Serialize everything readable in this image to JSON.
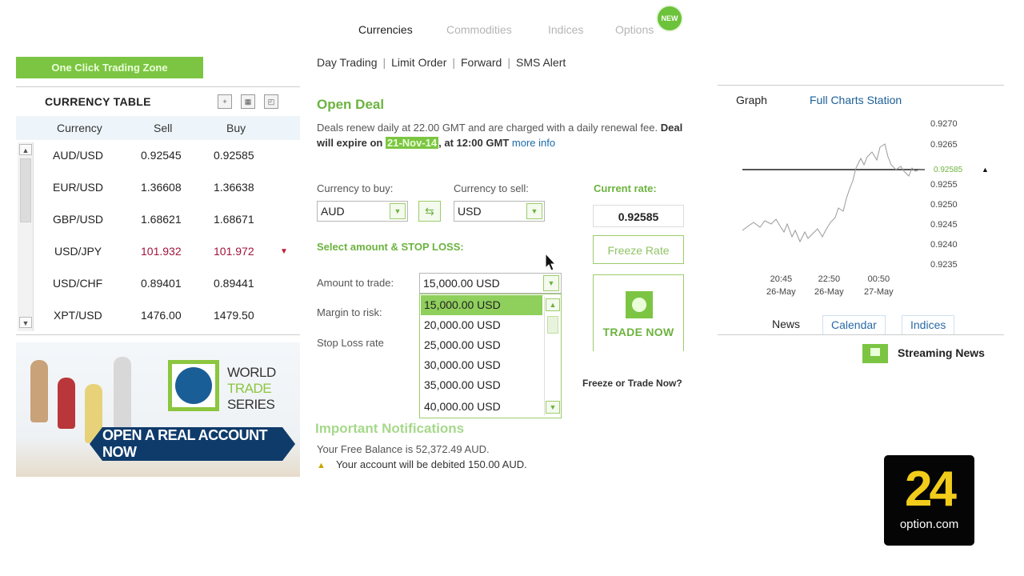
{
  "top_tabs": [
    "Currencies",
    "Commodities",
    "Indices",
    "Options"
  ],
  "new_badge": "NEW",
  "sub_nav": [
    "Day Trading",
    "Limit Order",
    "Forward",
    "SMS Alert"
  ],
  "one_click_label": "One Click Trading Zone",
  "currency_table": {
    "title": "CURRENCY TABLE",
    "columns": [
      "Currency",
      "Sell",
      "Buy"
    ],
    "rows": [
      {
        "pair": "AUD/USD",
        "sell": "0.92545",
        "buy": "0.92585"
      },
      {
        "pair": "EUR/USD",
        "sell": "1.36608",
        "buy": "1.36638"
      },
      {
        "pair": "GBP/USD",
        "sell": "1.68621",
        "buy": "1.68671"
      },
      {
        "pair": "USD/JPY",
        "sell": "101.932",
        "buy": "101.972"
      },
      {
        "pair": "USD/CHF",
        "sell": "0.89401",
        "buy": "0.89441"
      },
      {
        "pair": "XPT/USD",
        "sell": "1476.00",
        "buy": "1479.50"
      }
    ]
  },
  "banner": {
    "line1": "WORLD",
    "line2": "TRADE",
    "line3": "SERIES",
    "cta": "OPEN A REAL ACCOUNT NOW"
  },
  "deal": {
    "title": "Open Deal",
    "note_a": "Deals renew daily at 22.00 GMT and are charged with a daily renewal fee.",
    "note_b": "Deal will expire on",
    "date": "21-Nov-14",
    "note_c": ", at 12:00 GMT",
    "more_info": "more info",
    "buy_label": "Currency to buy:",
    "buy_value": "AUD",
    "sell_label": "Currency to sell:",
    "sell_value": "USD",
    "current_rate_label": "Current rate:",
    "current_rate": "0.92585",
    "select_label": "Select amount & STOP LOSS:",
    "amount_label": "Amount to trade:",
    "amount_value": "15,000.00 USD",
    "margin_label": "Margin to risk:",
    "stop_loss_label": "Stop Loss rate",
    "freeze_label": "Freeze Rate",
    "trade_label": "TRADE NOW",
    "freeze_question": "Freeze or Trade Now?"
  },
  "amount_options": [
    "15,000.00 USD",
    "20,000.00 USD",
    "25,000.00 USD",
    "30,000.00 USD",
    "35,000.00 USD",
    "40,000.00 USD"
  ],
  "notifications": {
    "title": "Important Notifications",
    "balance": "Your Free Balance is 52,372.49 AUD.",
    "debit": "Your account will be debited 150.00 AUD."
  },
  "graph": {
    "tab_graph": "Graph",
    "tab_full": "Full Charts Station",
    "y_ticks": [
      "0.9270",
      "0.9265",
      "0.9255",
      "0.9250",
      "0.9245",
      "0.9240",
      "0.9235"
    ],
    "x_ticks": [
      {
        "time": "20:45",
        "date": "26-May"
      },
      {
        "time": "22:50",
        "date": "26-May"
      },
      {
        "time": "00:50",
        "date": "27-May"
      }
    ],
    "current_value": "0.92585",
    "bottom_tabs": [
      "News",
      "Calendar",
      "Indices"
    ],
    "streaming": "Streaming News"
  },
  "logo": {
    "number": "24",
    "sub": "option.com"
  },
  "colors": {
    "accent": "#7cc543",
    "link": "#1a6aa8",
    "down": "#a3143a"
  }
}
